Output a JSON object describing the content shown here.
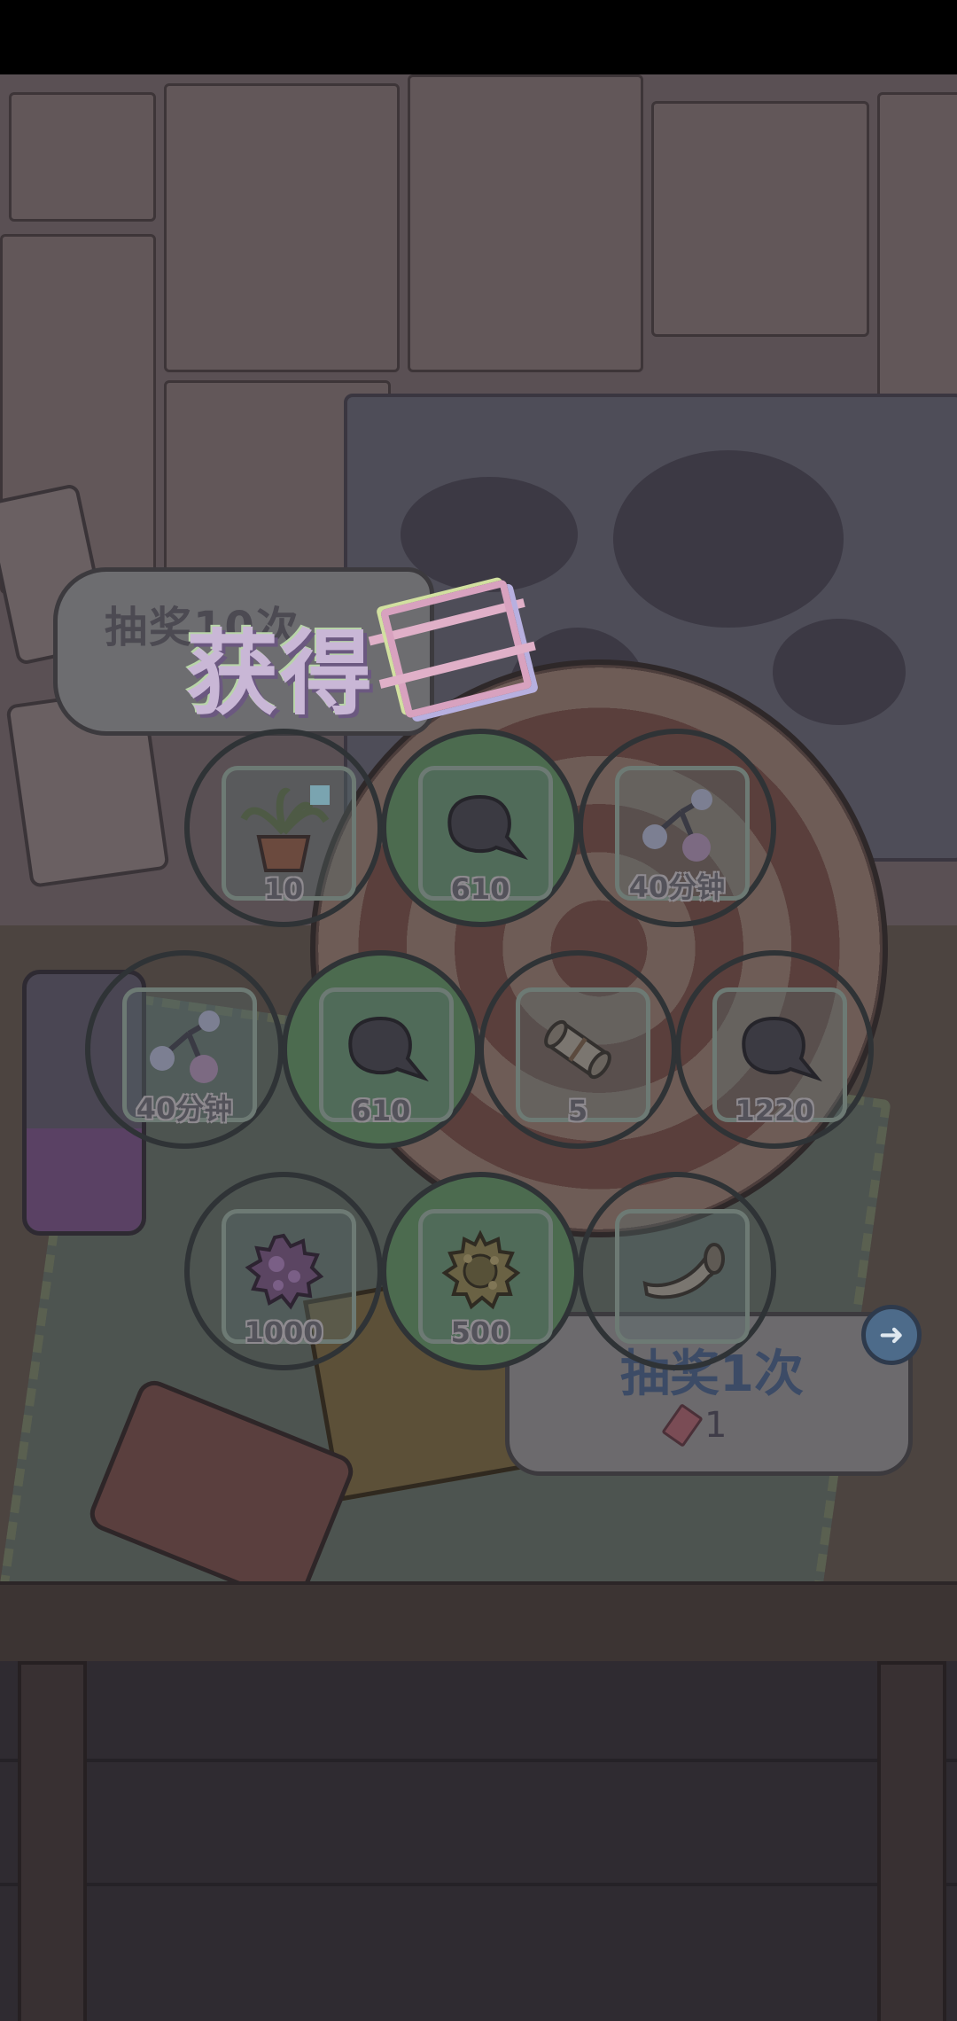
{
  "banner": {
    "draw_label": "抽奖10次"
  },
  "title": {
    "text": "获得"
  },
  "rewards": [
    {
      "icon": "potted-plant-icon",
      "amount": "10",
      "style": "teal"
    },
    {
      "icon": "dark-blob-icon",
      "amount": "610",
      "style": "green"
    },
    {
      "icon": "molecule-icon",
      "amount": "40分钟",
      "style": "teal"
    },
    {
      "icon": "molecule-icon",
      "amount": "40分钟",
      "style": "teal"
    },
    {
      "icon": "dark-blob-icon",
      "amount": "610",
      "style": "green"
    },
    {
      "icon": "scroll-icon",
      "amount": "5",
      "style": "teal"
    },
    {
      "icon": "dark-blob-icon",
      "amount": "1220",
      "style": "teal"
    },
    {
      "icon": "purple-microbe-icon",
      "amount": "1000",
      "style": "teal"
    },
    {
      "icon": "yellow-microbe-icon",
      "amount": "500",
      "style": "green"
    },
    {
      "icon": "horn-icon",
      "amount": "",
      "style": "teal"
    }
  ],
  "buy": {
    "label": "抽奖1次",
    "cost": "1",
    "cost_icon": "ticket-icon",
    "arrow_icon": "arrow-right-icon"
  }
}
